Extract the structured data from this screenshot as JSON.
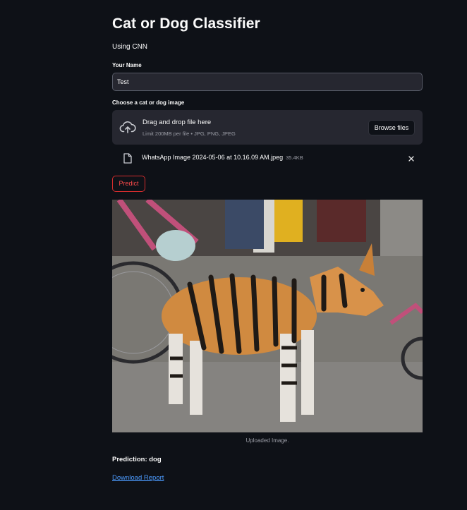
{
  "app": {
    "title": "Cat or Dog Classifier",
    "subtitle": "Using CNN"
  },
  "name_field": {
    "label": "Your Name",
    "value": "Test"
  },
  "uploader": {
    "label": "Choose a cat or dog image",
    "drag_text": "Drag and drop file here",
    "limit_text": "Limit 200MB per file • JPG, PNG, JPEG",
    "browse_label": "Browse files",
    "icon": "cloud-upload-icon"
  },
  "uploaded_file": {
    "name": "WhatsApp Image 2024-05-06 at 10.16.09 AM.jpeg",
    "size": "35.4KB",
    "icon": "file-icon",
    "remove_icon": "close-icon"
  },
  "predict_button": {
    "label": "Predict"
  },
  "image": {
    "caption": "Uploaded Image."
  },
  "result": {
    "prediction": "Prediction: dog",
    "download_label": "Download Report"
  },
  "colors": {
    "background": "#0e1117",
    "input_background": "#262730",
    "accent_red": "#ff4b4b",
    "link_blue": "#4c9bff"
  }
}
